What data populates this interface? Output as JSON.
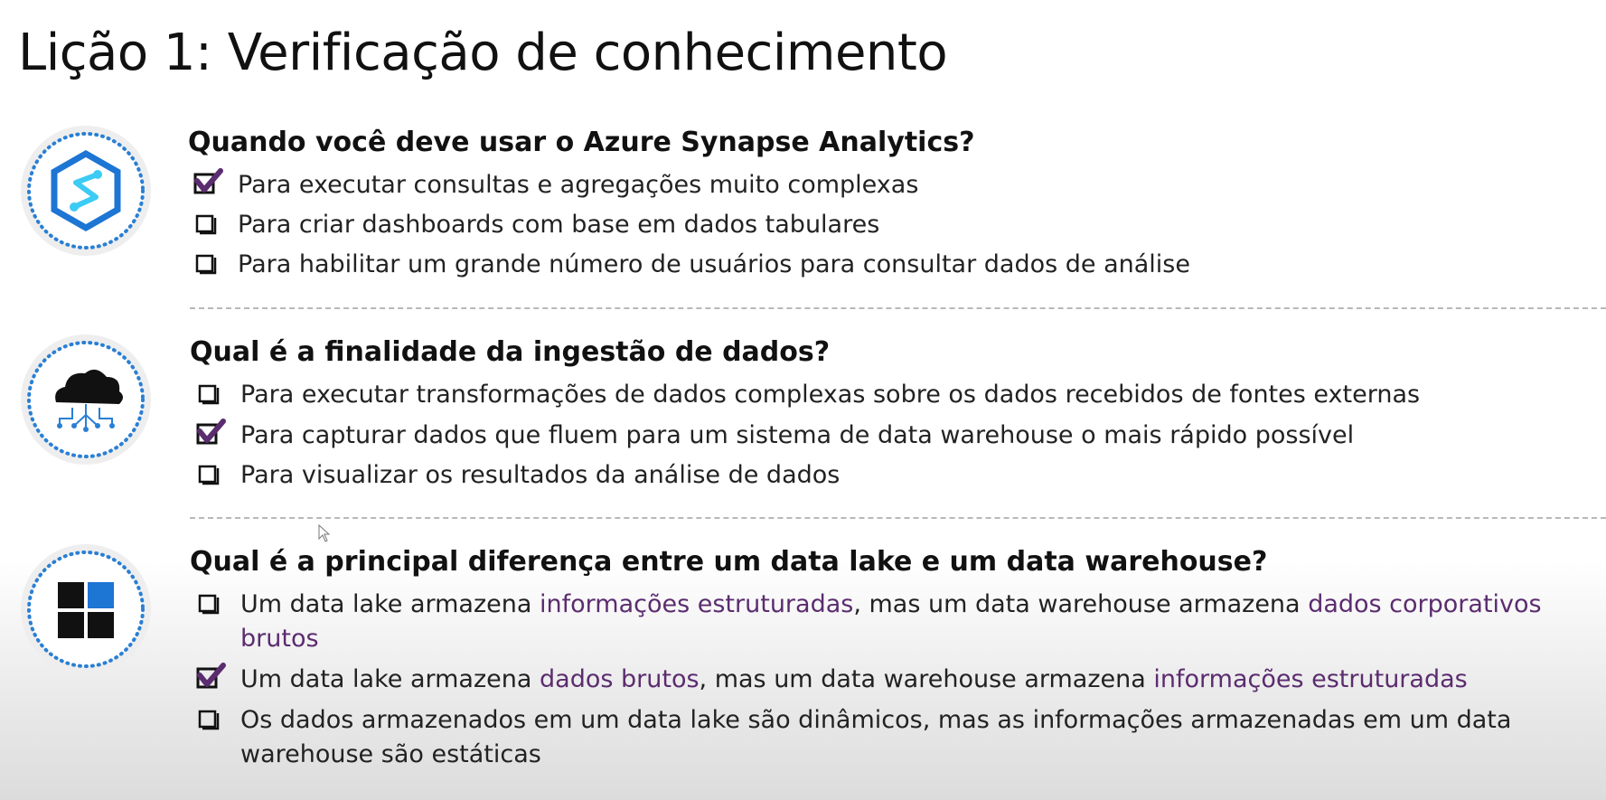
{
  "title": "Lição 1: Verificação de conhecimento",
  "colors": {
    "check": "#5b2c6f",
    "highlight": "#5b2c6f",
    "ring": "#2a7fd4",
    "synapse": "#1d75d4"
  },
  "questions": [
    {
      "icon": "azure-synapse-icon",
      "question": "Quando você deve usar o Azure Synapse Analytics?",
      "options": [
        {
          "checked": true,
          "text": "Para executar consultas e agregações muito complexas"
        },
        {
          "checked": false,
          "text": "Para criar dashboards com base em dados tabulares"
        },
        {
          "checked": false,
          "text": "Para habilitar um grande número de usuários para consultar dados de análise"
        }
      ]
    },
    {
      "icon": "cloud-ingestion-icon",
      "question": "Qual é a finalidade da ingestão de dados?",
      "options": [
        {
          "checked": false,
          "text": "Para executar transformações de dados complexas sobre os dados recebidos de fontes externas"
        },
        {
          "checked": true,
          "text": "Para capturar dados que fluem para um sistema de data warehouse o mais rápido possível"
        },
        {
          "checked": false,
          "text": "Para visualizar os resultados da análise de dados"
        }
      ]
    },
    {
      "icon": "data-warehouse-grid-icon",
      "question": "Qual é a principal diferença entre um data lake e um data warehouse?",
      "options": [
        {
          "checked": false,
          "parts": [
            "Um data lake armazena ",
            "informações estruturadas",
            ", mas um data warehouse armazena ",
            "dados corporativos brutos"
          ]
        },
        {
          "checked": true,
          "parts": [
            "Um data lake armazena ",
            "dados brutos",
            ", mas um data warehouse armazena ",
            "informações estruturadas"
          ]
        },
        {
          "checked": false,
          "text": "Os dados armazenados em um data lake são dinâmicos, mas as informações armazenadas em um data warehouse são estáticas"
        }
      ]
    }
  ]
}
